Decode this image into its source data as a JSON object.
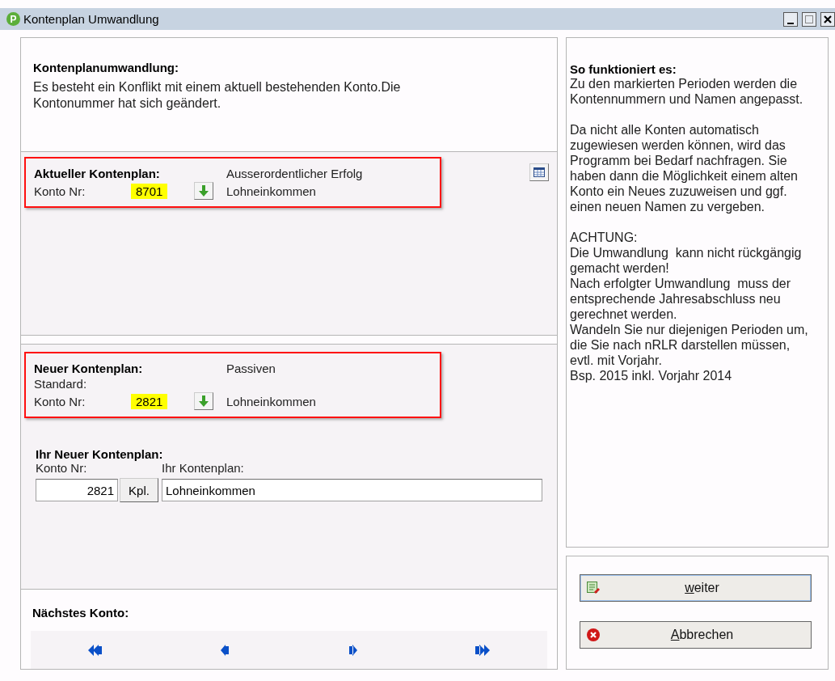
{
  "window": {
    "title": "Kontenplan Umwandlung",
    "app_icon": "P"
  },
  "intro": {
    "heading": "Kontenplanumwandlung:",
    "text": "Es besteht ein Konflikt mit einem aktuell bestehenden Konto.Die Kontonummer hat sich geändert."
  },
  "current_plan": {
    "marked": true,
    "heading": "Aktueller Kontenplan:",
    "group": "Ausserordentlicher Erfolg",
    "account_label": "Konto Nr:",
    "account_number": "8701",
    "highlighted": true,
    "account_name": "Lohneinkommen"
  },
  "new_plan": {
    "marked": true,
    "heading": "Neuer Kontenplan:",
    "group": "Passiven",
    "standard_label": "Standard:",
    "account_label": "Konto Nr:",
    "account_number": "2821",
    "highlighted": true,
    "account_name": "Lohneinkommen"
  },
  "your_plan": {
    "heading": "Ihr Neuer Kontenplan:",
    "account_label": "Konto Nr:",
    "plan_label": "Ihr Kontenplan:",
    "account_number": "2821",
    "plan_button": "Kpl.",
    "plan_name": "Lohneinkommen"
  },
  "next_account": {
    "heading": "Nächstes Konto:",
    "nav": [
      {
        "kind": "first"
      },
      {
        "kind": "prev"
      },
      {
        "kind": "next"
      },
      {
        "kind": "last"
      }
    ]
  },
  "help": {
    "heading": "So funktioniert es:",
    "blocks": [
      [
        "Zu den markierten Perioden werden die Kontennummern und Namen angepasst."
      ],
      [
        "Da nicht alle Konten automatisch zugewiesen werden können, wird das Programm bei Bedarf nachfragen. Sie haben dann die Möglichkeit einem alten Konto ein Neues zuzuweisen und ggf. einen neuen Namen zu vergeben."
      ],
      [
        "ACHTUNG:",
        "Die Umwandlung  kann nicht rückgängig gemacht werden!",
        "Nach erfolgter Umwandlung  muss der entsprechende Jahresabschluss neu gerechnet werden.",
        "Wandeln Sie nur diejenigen Perioden um, die Sie nach nRLR darstellen müssen, evtl. mit Vorjahr.",
        "Bsp. 2015 inkl. Vorjahr 2014"
      ]
    ]
  },
  "buttons": [
    {
      "kind": "next",
      "label": "weiter",
      "focused": true
    },
    {
      "kind": "cancel",
      "label": "Abbrechen",
      "focused": false
    }
  ]
}
